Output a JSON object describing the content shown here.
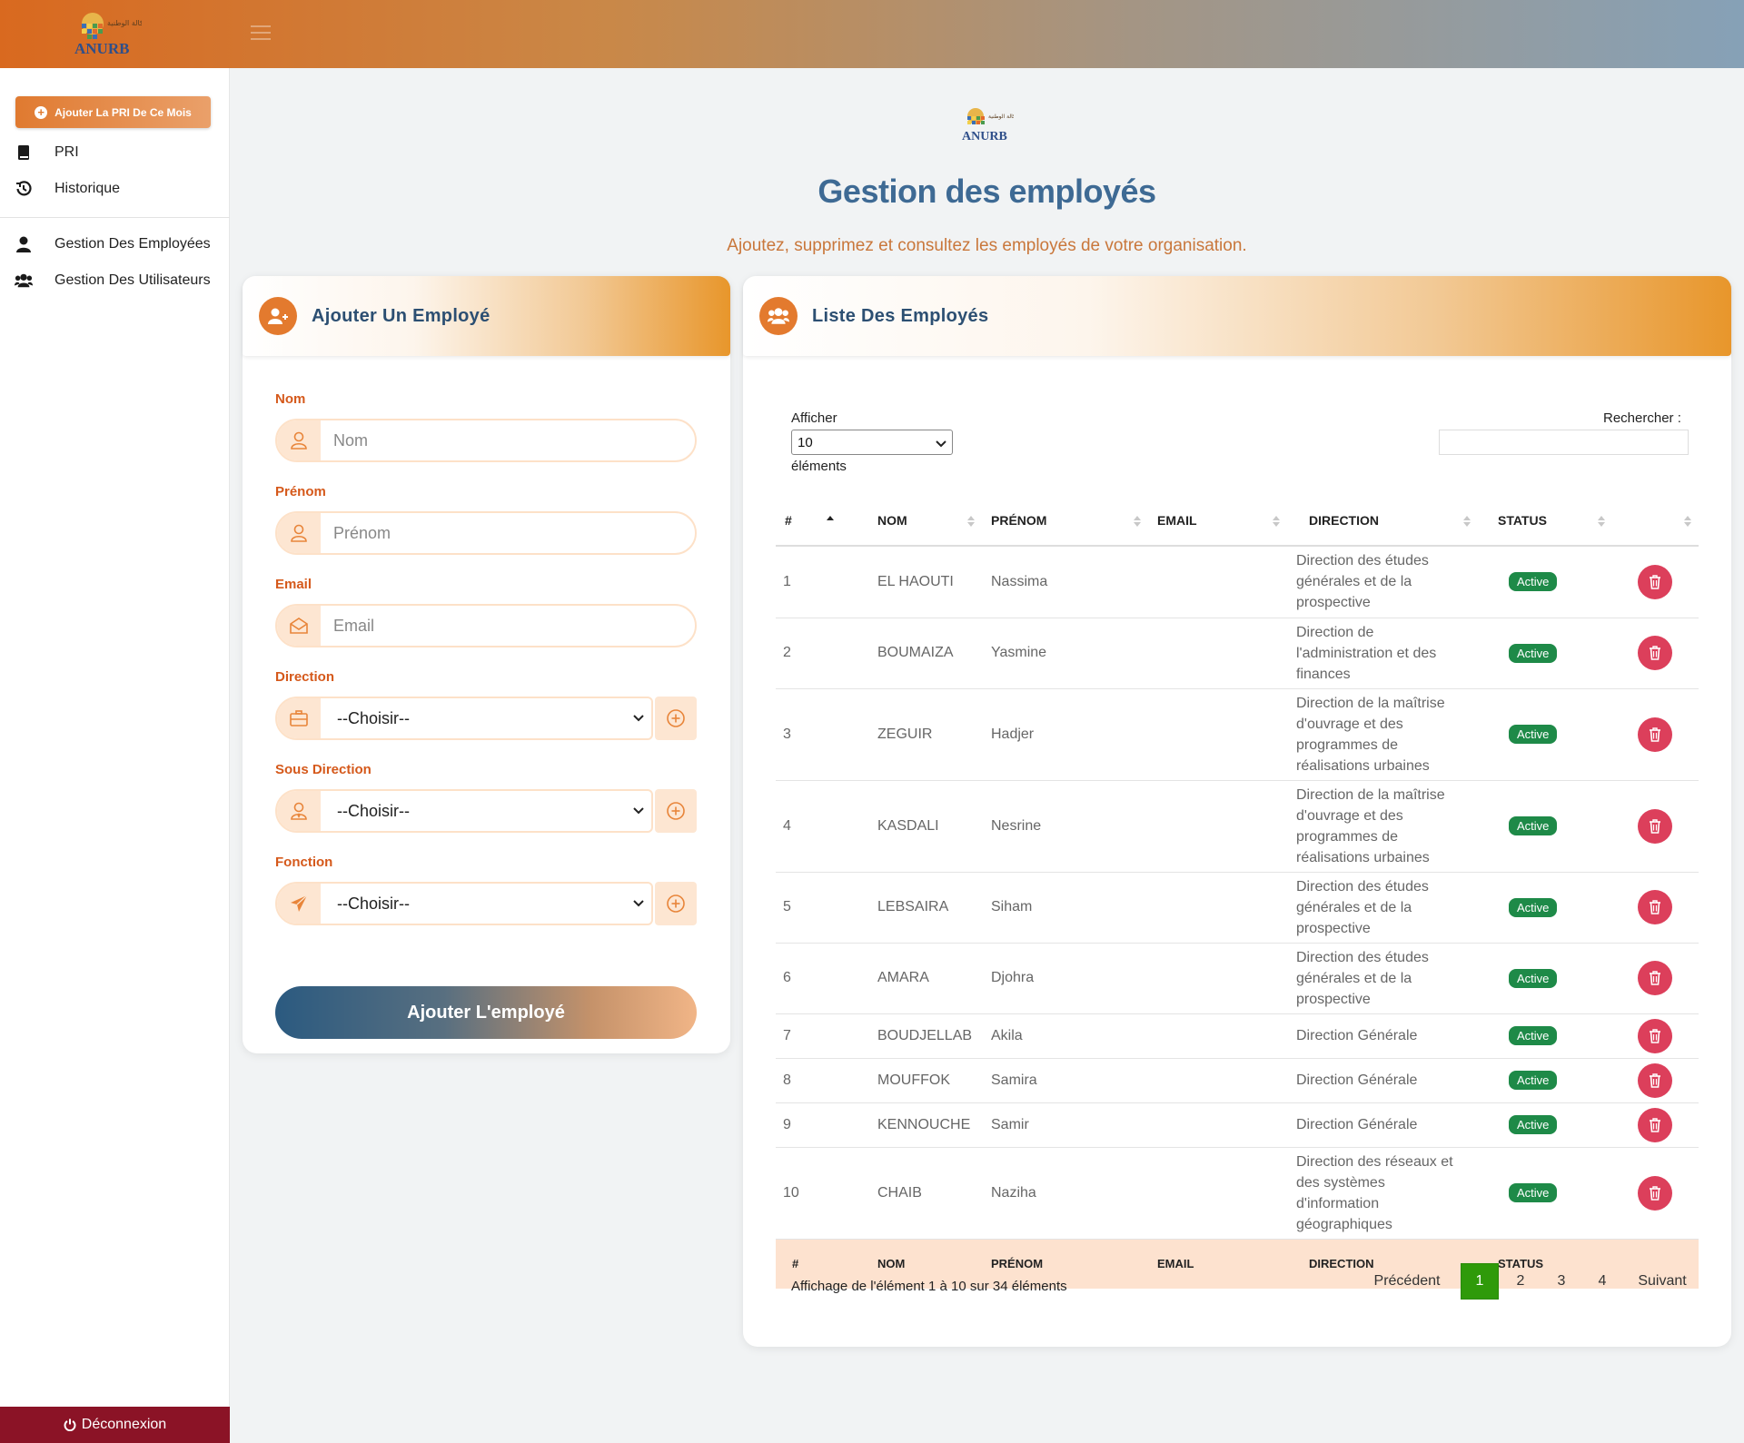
{
  "brand": {
    "logo_text": "ANURB",
    "logo_arabic": "الوكالة الوطنية"
  },
  "sidebar": {
    "cta_label": "Ajouter La PRI De Ce Mois",
    "items": [
      {
        "label": "PRI",
        "icon": "book-icon"
      },
      {
        "label": "Historique",
        "icon": "history-icon"
      },
      {
        "label": "Gestion Des Employées",
        "icon": "user-icon"
      },
      {
        "label": "Gestion Des Utilisateurs",
        "icon": "users-icon"
      }
    ],
    "logout_label": "Déconnexion"
  },
  "header": {
    "title": "Gestion des employés",
    "subtitle": "Ajoutez, supprimez et consultez les employés de votre organisation."
  },
  "form": {
    "title": "Ajouter Un Employé",
    "nom_label": "Nom",
    "nom_placeholder": "Nom",
    "prenom_label": "Prénom",
    "prenom_placeholder": "Prénom",
    "email_label": "Email",
    "email_placeholder": "Email",
    "direction_label": "Direction",
    "direction_value": "--Choisir--",
    "sous_direction_label": "Sous Direction",
    "sous_direction_value": "--Choisir--",
    "fonction_label": "Fonction",
    "fonction_value": "--Choisir--",
    "submit_label": "Ajouter L'employé"
  },
  "list": {
    "title": "Liste Des Employés",
    "show_label": "Afficher",
    "page_length": "10",
    "elements_label": "éléments",
    "search_label": "Rechercher :",
    "columns": [
      "#",
      "NOM",
      "PRÉNOM",
      "EMAIL",
      "DIRECTION",
      "STATUS"
    ],
    "rows": [
      {
        "id": "1",
        "nom": "EL HAOUTI",
        "prenom": "Nassima",
        "email": "",
        "direction": "Direction des études générales et de la prospective",
        "status": "Active"
      },
      {
        "id": "2",
        "nom": "BOUMAIZA",
        "prenom": "Yasmine",
        "email": "",
        "direction": "Direction de l'administration et des finances",
        "status": "Active"
      },
      {
        "id": "3",
        "nom": "ZEGUIR",
        "prenom": "Hadjer",
        "email": "",
        "direction": "Direction de la maîtrise d'ouvrage et des programmes de réalisations urbaines",
        "status": "Active"
      },
      {
        "id": "4",
        "nom": "KASDALI",
        "prenom": "Nesrine",
        "email": "",
        "direction": "Direction de la maîtrise d'ouvrage et des programmes de réalisations urbaines",
        "status": "Active"
      },
      {
        "id": "5",
        "nom": "LEBSAIRA",
        "prenom": "Siham",
        "email": "",
        "direction": "Direction des études générales et de la prospective",
        "status": "Active"
      },
      {
        "id": "6",
        "nom": "AMARA",
        "prenom": "Djohra",
        "email": "",
        "direction": "Direction des études générales et de la prospective",
        "status": "Active"
      },
      {
        "id": "7",
        "nom": "BOUDJELLAB",
        "prenom": "Akila",
        "email": "",
        "direction": "Direction Générale",
        "status": "Active"
      },
      {
        "id": "8",
        "nom": "MOUFFOK",
        "prenom": "Samira",
        "email": "",
        "direction": "Direction Générale",
        "status": "Active"
      },
      {
        "id": "9",
        "nom": "KENNOUCHE",
        "prenom": "Samir",
        "email": "",
        "direction": "Direction Générale",
        "status": "Active"
      },
      {
        "id": "10",
        "nom": "CHAIB",
        "prenom": "Naziha",
        "email": "",
        "direction": "Direction des réseaux et des systèmes d'information géographiques",
        "status": "Active"
      }
    ],
    "info": "Affichage de l'élément 1 à 10 sur 34 éléments",
    "pagination": {
      "previous": "Précédent",
      "pages": [
        "1",
        "2",
        "3",
        "4"
      ],
      "current": "1",
      "next": "Suivant"
    }
  },
  "colors": {
    "accent": "#e37a2e",
    "title": "#3e6a94",
    "badge": "#1e8a48",
    "delete": "#dc3f5b",
    "logout": "#8b1326"
  }
}
